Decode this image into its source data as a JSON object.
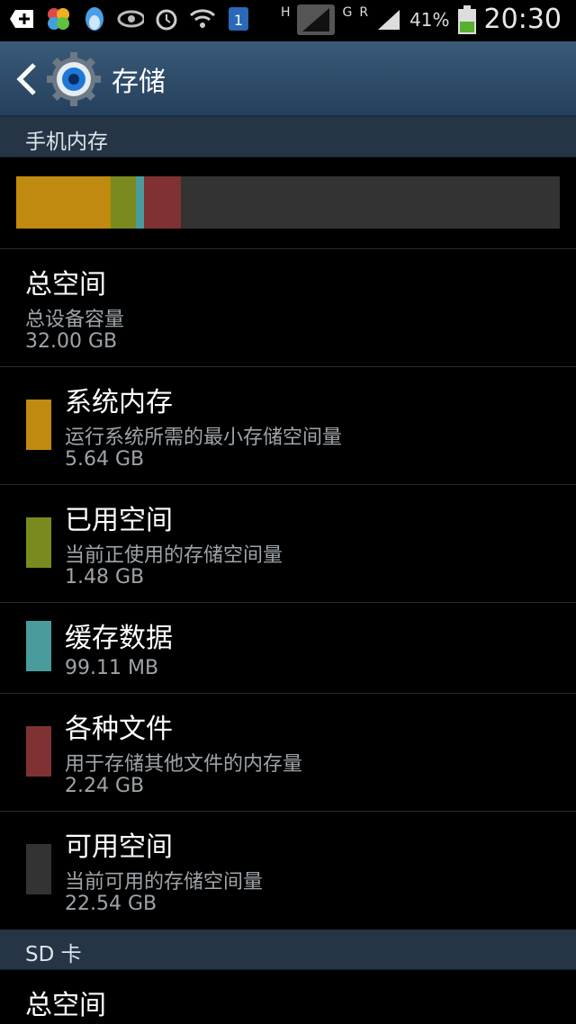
{
  "statusbar": {
    "network_label": "H",
    "net2_label": "G",
    "roaming": "R",
    "battery": "41%",
    "time": "20:30",
    "sim_label": "1"
  },
  "header": {
    "title": "存储"
  },
  "sections": {
    "internal": "手机内存",
    "sd": "SD 卡"
  },
  "total": {
    "title": "总空间",
    "subtitle": "总设备容量",
    "value": "32.00 GB"
  },
  "categories": [
    {
      "title": "系统内存",
      "subtitle": "运行系统所需的最小存储空间量",
      "value": "5.64 GB",
      "color": "#c08a10",
      "fraction": 0.1762
    },
    {
      "title": "已用空间",
      "subtitle": "当前正使用的存储空间量",
      "value": "1.48 GB",
      "color": "#7a8a1e",
      "fraction": 0.0463
    },
    {
      "title": "缓存数据",
      "subtitle": "",
      "value": "99.11 MB",
      "color": "#4a9c9c",
      "fraction": 0.0148
    },
    {
      "title": "各种文件",
      "subtitle": "用于存储其他文件的内存量",
      "value": "2.24 GB",
      "color": "#803232",
      "fraction": 0.07
    },
    {
      "title": "可用空间",
      "subtitle": "当前可用的存储空间量",
      "value": "22.54 GB",
      "color": "#333333",
      "fraction": 0.7044
    }
  ],
  "sd_total": {
    "title": "总空间"
  }
}
